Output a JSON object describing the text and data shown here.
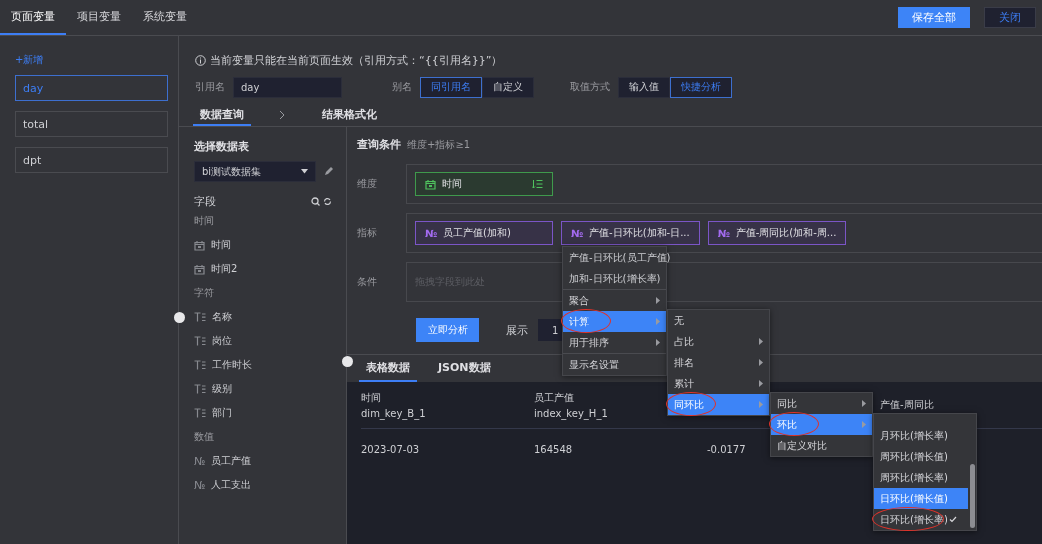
{
  "top_tabs": [
    {
      "label": "页面变量",
      "selected": true
    },
    {
      "label": "项目变量",
      "selected": false
    },
    {
      "label": "系统变量",
      "selected": false
    }
  ],
  "header_buttons": [
    {
      "label": "保存全部",
      "kind": "primary"
    },
    {
      "label": "关闭",
      "kind": "secondary"
    }
  ],
  "sidebar": {
    "add_link": "+新增",
    "items": [
      {
        "label": "day",
        "selected": true
      },
      {
        "label": "total",
        "selected": false
      },
      {
        "label": "dpt",
        "selected": false
      }
    ]
  },
  "notice": "当前变量只能在当前页面生效（引用方式：“{{引用名}}”）",
  "reference": {
    "label": "引用名",
    "value": "day"
  },
  "alias": {
    "label": "别名",
    "options": [
      {
        "label": "同引用名",
        "selected": true
      },
      {
        "label": "自定义",
        "selected": false
      }
    ]
  },
  "value_mode": {
    "label": "取值方式",
    "options": [
      {
        "label": "输入值",
        "selected": false
      },
      {
        "label": "快捷分析",
        "selected": true
      }
    ]
  },
  "steps": [
    {
      "label": "数据查询",
      "selected": true
    },
    {
      "label": "结果格式化",
      "selected": false
    }
  ],
  "data_source": {
    "title": "选择数据表",
    "dataset": "bi测试数据集",
    "fields_title": "字段",
    "groups": [
      {
        "name": "时间",
        "fields": [
          {
            "label": "时间",
            "kind": "date"
          },
          {
            "label": "时间2",
            "kind": "date"
          }
        ]
      },
      {
        "name": "字符",
        "fields": [
          {
            "label": "名称",
            "kind": "text"
          },
          {
            "label": "岗位",
            "kind": "text"
          },
          {
            "label": "工作时长",
            "kind": "text"
          },
          {
            "label": "级别",
            "kind": "text"
          },
          {
            "label": "部门",
            "kind": "text"
          }
        ]
      },
      {
        "name": "数值",
        "fields": [
          {
            "label": "员工产值",
            "kind": "number",
            "glyph": "№"
          },
          {
            "label": "人工支出",
            "kind": "number",
            "glyph": "№"
          }
        ]
      }
    ]
  },
  "query": {
    "title": "查询条件",
    "hint": "维度+指标≥1",
    "rows": [
      {
        "label": "维度",
        "pills": [
          {
            "label": "时间",
            "kind": "dimension"
          }
        ]
      },
      {
        "label": "指标",
        "pills": [
          {
            "label": "员工产值(加和)",
            "kind": "measure",
            "glyph": "№"
          },
          {
            "label": "产值-日环比(加和-日...",
            "kind": "measure",
            "glyph": "№"
          },
          {
            "label": "产值-周同比(加和-周...",
            "kind": "measure",
            "glyph": "№"
          }
        ]
      },
      {
        "label": "条件",
        "placeholder": "拖拽字段到此处"
      }
    ],
    "analyze_button": "立即分析",
    "show_label": "展示",
    "show_value": "1"
  },
  "result_tabs": [
    {
      "label": "表格数据",
      "selected": true
    },
    {
      "label": "JSON数据",
      "selected": false
    }
  ],
  "table": {
    "columns": [
      {
        "title": "时间",
        "key": "dim_key_B_1"
      },
      {
        "title": "员工产值",
        "key": "index_key_H_1"
      },
      {},
      {
        "title": "产值-周同比"
      }
    ],
    "rows": [
      [
        "2023-07-03",
        "164548",
        "-0.0177"
      ]
    ]
  },
  "context_menus": [
    {
      "items": [
        {
          "label": "产值-日环比(员工产值)",
          "kind": "info"
        },
        {
          "label": "加和-日环比(增长率)",
          "kind": "info"
        },
        {
          "label": "聚合",
          "kind": "submenu",
          "divider_above": true,
          "selected": false,
          "circled": false
        },
        {
          "label": "计算",
          "kind": "submenu",
          "selected": true,
          "circled": true
        },
        {
          "label": "用于排序",
          "kind": "submenu",
          "selected": false,
          "circled": false
        },
        {
          "label": "显示名设置",
          "kind": "action",
          "divider_above": true,
          "selected": false,
          "circled": false
        }
      ]
    },
    {
      "items": [
        {
          "label": "无",
          "kind": "action",
          "selected": false,
          "circled": false
        },
        {
          "label": "占比",
          "kind": "submenu",
          "selected": false,
          "circled": false
        },
        {
          "label": "排名",
          "kind": "submenu",
          "selected": false,
          "circled": false
        },
        {
          "label": "累计",
          "kind": "submenu",
          "selected": false,
          "circled": false
        },
        {
          "label": "同环比",
          "kind": "submenu",
          "selected": true,
          "circled": true
        }
      ]
    },
    {
      "items": [
        {
          "label": "同比",
          "kind": "submenu",
          "selected": false,
          "circled": false
        },
        {
          "label": "环比",
          "kind": "submenu",
          "selected": true,
          "circled": true
        },
        {
          "label": "自定义对比",
          "kind": "action",
          "selected": false,
          "circled": false
        }
      ]
    },
    {
      "items": [
        {
          "label": "月环比(增长率)",
          "kind": "action",
          "selected": false,
          "circled": false,
          "checked": false
        },
        {
          "label": "周环比(增长值)",
          "kind": "action",
          "selected": false,
          "circled": false,
          "checked": false
        },
        {
          "label": "周环比(增长率)",
          "kind": "action",
          "selected": false,
          "circled": false,
          "checked": false
        },
        {
          "label": "日环比(增长值)",
          "kind": "action",
          "selected": true,
          "circled": false,
          "checked": false
        },
        {
          "label": "日环比(增长率)",
          "kind": "action",
          "selected": false,
          "circled": true,
          "checked": true
        }
      ]
    }
  ]
}
